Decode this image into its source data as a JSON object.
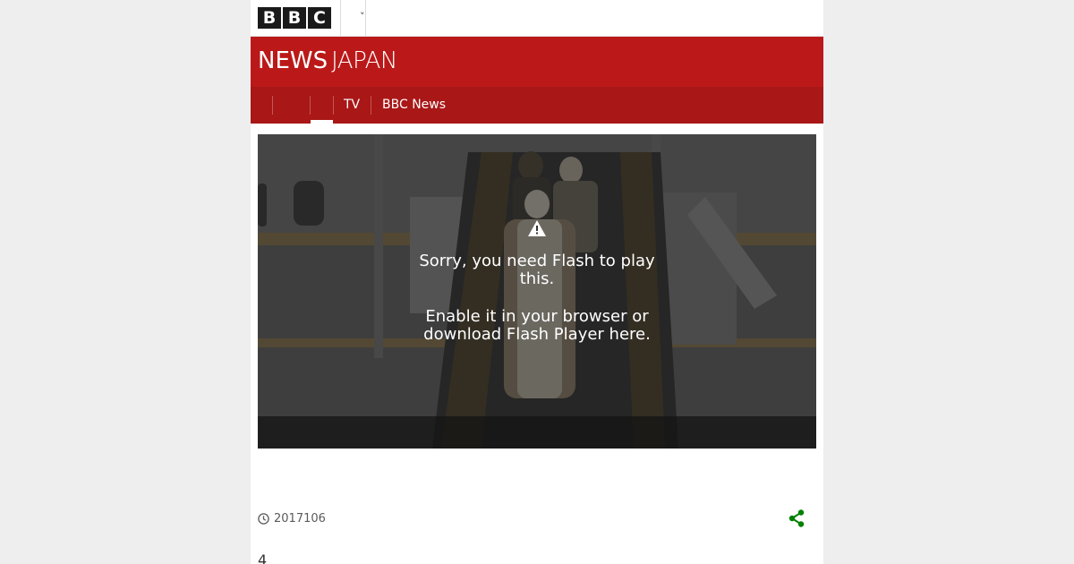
{
  "masthead": {
    "logo_letters": [
      "B",
      "B",
      "C"
    ],
    "menu_chevron": "˅"
  },
  "banner": {
    "news_word": "NEWS",
    "region_word": "JAPAN"
  },
  "nav": {
    "items": [
      {
        "label": ""
      },
      {
        "label": ""
      },
      {
        "label": "TV"
      },
      {
        "label": "BBC News"
      }
    ]
  },
  "video": {
    "warning_icon": "warning-triangle-icon",
    "message_line1": "Sorry, you need Flash to play this.",
    "message_line2": "Enable it in your browser or download Flash Player here."
  },
  "meta": {
    "timestamp": "2017106",
    "clock_icon": "clock-icon",
    "share_icon": "share-icon"
  },
  "article": {
    "first_line": "4"
  },
  "colors": {
    "banner_red": "#bb1919",
    "nav_red": "#a91717",
    "share_green": "#008000",
    "page_bg": "#eeeeee"
  }
}
